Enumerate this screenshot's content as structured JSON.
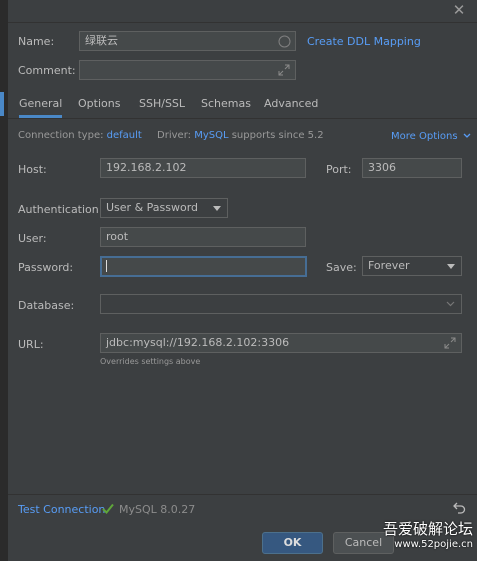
{
  "dialog": {
    "close_glyph": "✕"
  },
  "general": {
    "name_label": "Name:",
    "name_value": "绿联云",
    "create_ddl_link": "Create DDL Mapping",
    "comment_label": "Comment:",
    "comment_value": ""
  },
  "tabs": [
    {
      "label": "General",
      "active": true
    },
    {
      "label": "Options",
      "active": false
    },
    {
      "label": "SSH/SSL",
      "active": false
    },
    {
      "label": "Schemas",
      "active": false
    },
    {
      "label": "Advanced",
      "active": false
    }
  ],
  "connection": {
    "type_label": "Connection type:",
    "type_value": "default",
    "driver_label": "Driver:",
    "driver_value": "MySQL",
    "driver_note": "supports since 5.2",
    "more_options": "More Options"
  },
  "form": {
    "host_label": "Host:",
    "host_value": "192.168.2.102",
    "port_label": "Port:",
    "port_value": "3306",
    "auth_label": "Authentication:",
    "auth_value": "User & Password",
    "user_label": "User:",
    "user_value": "root",
    "password_label": "Password:",
    "password_value": "",
    "save_label": "Save:",
    "save_value": "Forever",
    "database_label": "Database:",
    "database_value": "",
    "url_label": "URL:",
    "url_value": "jdbc:mysql://192.168.2.102:3306",
    "url_note": "Overrides settings above"
  },
  "footer": {
    "test_connection": "Test Connection",
    "test_status": "MySQL 8.0.27",
    "ok_label": "OK",
    "cancel_label": "Cancel"
  },
  "watermark": {
    "line1": "吾爱破解论坛",
    "line2": "www.52pojie.cn"
  },
  "colors": {
    "background": "#3c3f41",
    "link": "#589df6",
    "accent": "#4a88c7",
    "success": "#5fa63a",
    "primary_button": "#365880"
  },
  "icons": {
    "close": "close-icon",
    "expand": "expand-icon",
    "chevron": "chevron-down-icon",
    "check": "check-icon",
    "revert": "revert-icon"
  }
}
